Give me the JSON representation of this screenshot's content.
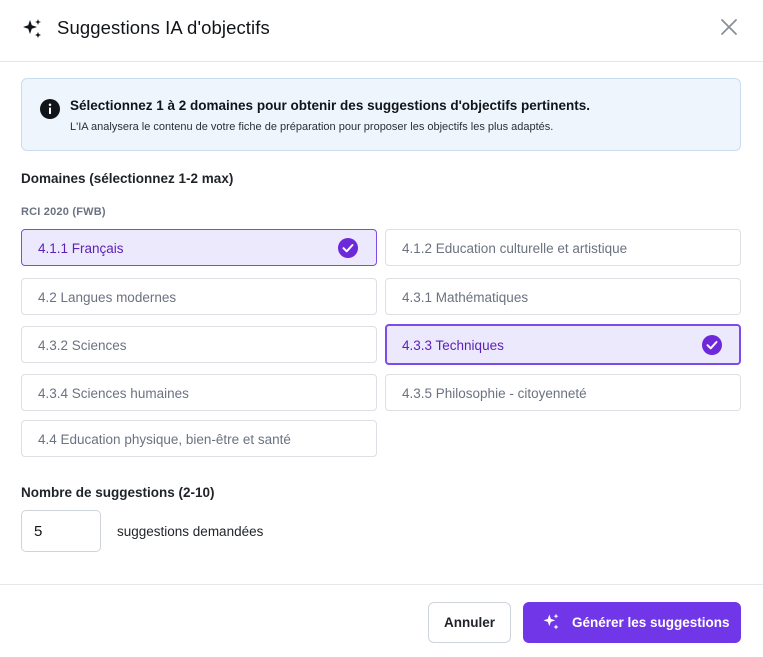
{
  "dialog": {
    "title": "Suggestions IA d'objectifs",
    "icon": "sparkle-icon"
  },
  "info": {
    "title": "Sélectionnez 1 à 2 domaines pour obtenir des suggestions d'objectifs pertinents.",
    "description": "L'IA analysera le contenu de votre fiche de préparation pour proposer les objectifs les plus adaptés."
  },
  "domains": {
    "label": "Domaines (sélectionnez 1-2 max)",
    "group_label": "RCI 2020 (FWB)",
    "options": [
      {
        "label": "4.1.1 Français",
        "selected": true
      },
      {
        "label": "4.1.2 Education culturelle et artistique",
        "selected": false
      },
      {
        "label": "4.2 Langues modernes",
        "selected": false
      },
      {
        "label": "4.3.1 Mathématiques",
        "selected": false
      },
      {
        "label": "4.3.2 Sciences",
        "selected": false
      },
      {
        "label": "4.3.3 Techniques",
        "selected": true
      },
      {
        "label": "4.3.4 Sciences humaines",
        "selected": false
      },
      {
        "label": "4.3.5 Philosophie - citoyenneté",
        "selected": false
      },
      {
        "label": "4.4 Education physique, bien-être et santé",
        "selected": false
      }
    ]
  },
  "suggestions": {
    "label": "Nombre de suggestions (2-10)",
    "value": "5",
    "suffix": "suggestions demandées"
  },
  "footer": {
    "cancel_label": "Annuler",
    "generate_label": "Générer les suggestions"
  },
  "colors": {
    "accent": "#7136e8",
    "selected_bg": "#ede9fd",
    "info_bg": "#eef5fd"
  }
}
